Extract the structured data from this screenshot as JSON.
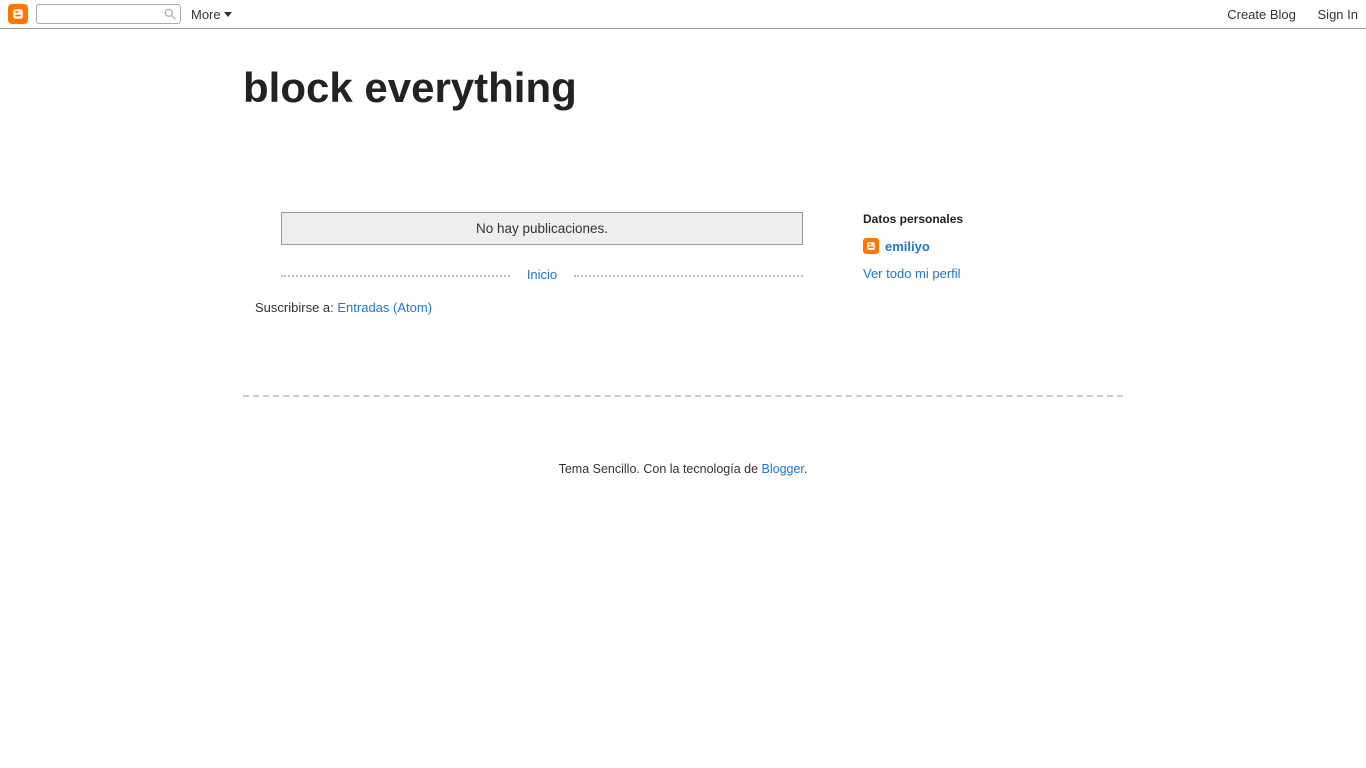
{
  "navbar": {
    "more_label": "More",
    "create_blog_label": "Create Blog",
    "sign_in_label": "Sign In"
  },
  "blog": {
    "title": "block everything"
  },
  "main": {
    "no_posts_message": "No hay publicaciones.",
    "home_link_label": "Inicio",
    "subscribe_prefix": "Suscribirse a: ",
    "subscribe_link_label": "Entradas (Atom)"
  },
  "sidebar": {
    "profile_widget_title": "Datos personales",
    "profile_name": "emiliyo",
    "view_profile_label": "Ver todo mi perfil"
  },
  "footer": {
    "theme_text": "Tema Sencillo. Con la tecnología de ",
    "platform_link_label": "Blogger",
    "suffix": "."
  }
}
